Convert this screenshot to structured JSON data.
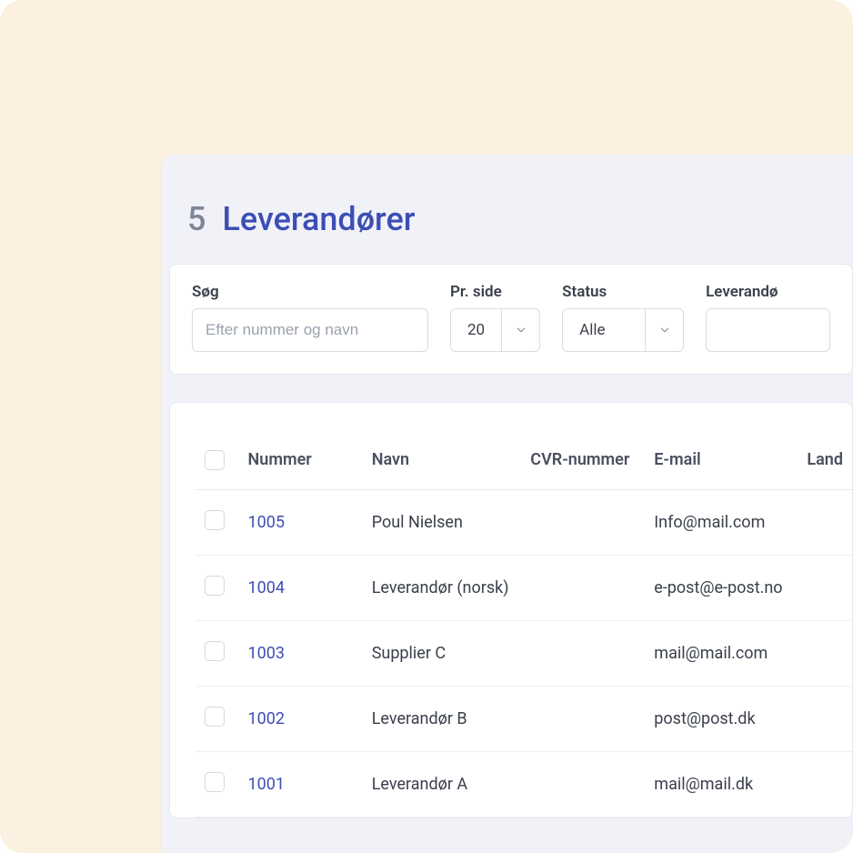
{
  "header": {
    "count": "5",
    "title": "Leverandører"
  },
  "filters": {
    "search": {
      "label": "Søg",
      "placeholder": "Efter nummer og navn"
    },
    "perPage": {
      "label": "Pr. side",
      "value": "20"
    },
    "status": {
      "label": "Status",
      "value": "Alle"
    },
    "type": {
      "label": "Leverandø",
      "value": ""
    }
  },
  "table": {
    "columns": {
      "nummer": "Nummer",
      "navn": "Navn",
      "cvr": "CVR-nummer",
      "email": "E-mail",
      "land": "Land"
    },
    "rows": [
      {
        "nummer": "1005",
        "navn": "Poul Nielsen",
        "cvr": "",
        "email": "Info@mail.com",
        "land": ""
      },
      {
        "nummer": "1004",
        "navn": "Leverandør (norsk)",
        "cvr": "",
        "email": "e-post@e-post.no",
        "land": ""
      },
      {
        "nummer": "1003",
        "navn": "Supplier C",
        "cvr": "",
        "email": "mail@mail.com",
        "land": ""
      },
      {
        "nummer": "1002",
        "navn": "Leverandør B",
        "cvr": "",
        "email": "post@post.dk",
        "land": ""
      },
      {
        "nummer": "1001",
        "navn": "Leverandør A",
        "cvr": "",
        "email": "mail@mail.dk",
        "land": ""
      }
    ]
  }
}
